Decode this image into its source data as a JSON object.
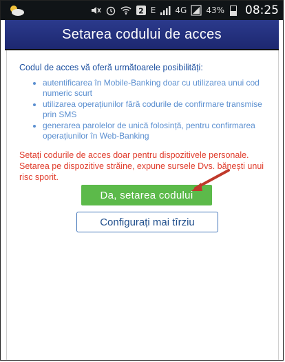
{
  "status_bar": {
    "network": "4G",
    "network_prefix": "E",
    "battery": "43%",
    "battery_level": 0.43,
    "time": "08:25",
    "icons": [
      "weather-icon",
      "mute-icon",
      "alarm-icon",
      "wifi-icon",
      "sim2-icon",
      "signal-icon",
      "battery-icon"
    ]
  },
  "header": {
    "title": "Setarea codului de acces"
  },
  "content": {
    "intro": "Codul de acces vă oferă următoarele posibilități:",
    "features": [
      "autentificarea în Mobile-Banking doar cu utilizarea unui cod numeric scurt",
      "utilizarea operațiunilor fără codurile de confirmare transmise prin SMS",
      "generarea parolelor de unică folosință, pentru confirmarea operațiunilor în Web-Banking"
    ],
    "warning": "Setați codurile de acces doar pentru dispozitivele personale. Setarea pe dispozitive străine, expune sursele Dvs. bănești unui risc sporit."
  },
  "buttons": {
    "primary": "Da, setarea codului",
    "secondary": "Configurați mai tîrziu"
  },
  "colors": {
    "header_bg": "#24307c",
    "primary_btn": "#5cba4a",
    "warning_text": "#e03c2c",
    "intro_text": "#1a4e9f",
    "annotation_arrow": "#c0392b"
  }
}
